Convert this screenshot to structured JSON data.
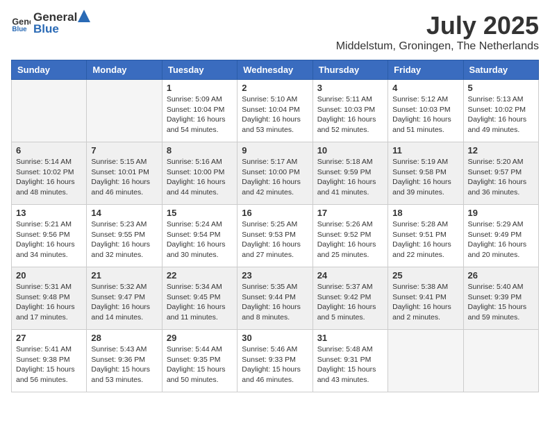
{
  "header": {
    "logo_general": "General",
    "logo_blue": "Blue",
    "month_title": "July 2025",
    "location": "Middelstum, Groningen, The Netherlands"
  },
  "weekdays": [
    "Sunday",
    "Monday",
    "Tuesday",
    "Wednesday",
    "Thursday",
    "Friday",
    "Saturday"
  ],
  "weeks": [
    [
      {
        "day": "",
        "info": ""
      },
      {
        "day": "",
        "info": ""
      },
      {
        "day": "1",
        "info": "Sunrise: 5:09 AM\nSunset: 10:04 PM\nDaylight: 16 hours\nand 54 minutes."
      },
      {
        "day": "2",
        "info": "Sunrise: 5:10 AM\nSunset: 10:04 PM\nDaylight: 16 hours\nand 53 minutes."
      },
      {
        "day": "3",
        "info": "Sunrise: 5:11 AM\nSunset: 10:03 PM\nDaylight: 16 hours\nand 52 minutes."
      },
      {
        "day": "4",
        "info": "Sunrise: 5:12 AM\nSunset: 10:03 PM\nDaylight: 16 hours\nand 51 minutes."
      },
      {
        "day": "5",
        "info": "Sunrise: 5:13 AM\nSunset: 10:02 PM\nDaylight: 16 hours\nand 49 minutes."
      }
    ],
    [
      {
        "day": "6",
        "info": "Sunrise: 5:14 AM\nSunset: 10:02 PM\nDaylight: 16 hours\nand 48 minutes."
      },
      {
        "day": "7",
        "info": "Sunrise: 5:15 AM\nSunset: 10:01 PM\nDaylight: 16 hours\nand 46 minutes."
      },
      {
        "day": "8",
        "info": "Sunrise: 5:16 AM\nSunset: 10:00 PM\nDaylight: 16 hours\nand 44 minutes."
      },
      {
        "day": "9",
        "info": "Sunrise: 5:17 AM\nSunset: 10:00 PM\nDaylight: 16 hours\nand 42 minutes."
      },
      {
        "day": "10",
        "info": "Sunrise: 5:18 AM\nSunset: 9:59 PM\nDaylight: 16 hours\nand 41 minutes."
      },
      {
        "day": "11",
        "info": "Sunrise: 5:19 AM\nSunset: 9:58 PM\nDaylight: 16 hours\nand 39 minutes."
      },
      {
        "day": "12",
        "info": "Sunrise: 5:20 AM\nSunset: 9:57 PM\nDaylight: 16 hours\nand 36 minutes."
      }
    ],
    [
      {
        "day": "13",
        "info": "Sunrise: 5:21 AM\nSunset: 9:56 PM\nDaylight: 16 hours\nand 34 minutes."
      },
      {
        "day": "14",
        "info": "Sunrise: 5:23 AM\nSunset: 9:55 PM\nDaylight: 16 hours\nand 32 minutes."
      },
      {
        "day": "15",
        "info": "Sunrise: 5:24 AM\nSunset: 9:54 PM\nDaylight: 16 hours\nand 30 minutes."
      },
      {
        "day": "16",
        "info": "Sunrise: 5:25 AM\nSunset: 9:53 PM\nDaylight: 16 hours\nand 27 minutes."
      },
      {
        "day": "17",
        "info": "Sunrise: 5:26 AM\nSunset: 9:52 PM\nDaylight: 16 hours\nand 25 minutes."
      },
      {
        "day": "18",
        "info": "Sunrise: 5:28 AM\nSunset: 9:51 PM\nDaylight: 16 hours\nand 22 minutes."
      },
      {
        "day": "19",
        "info": "Sunrise: 5:29 AM\nSunset: 9:49 PM\nDaylight: 16 hours\nand 20 minutes."
      }
    ],
    [
      {
        "day": "20",
        "info": "Sunrise: 5:31 AM\nSunset: 9:48 PM\nDaylight: 16 hours\nand 17 minutes."
      },
      {
        "day": "21",
        "info": "Sunrise: 5:32 AM\nSunset: 9:47 PM\nDaylight: 16 hours\nand 14 minutes."
      },
      {
        "day": "22",
        "info": "Sunrise: 5:34 AM\nSunset: 9:45 PM\nDaylight: 16 hours\nand 11 minutes."
      },
      {
        "day": "23",
        "info": "Sunrise: 5:35 AM\nSunset: 9:44 PM\nDaylight: 16 hours\nand 8 minutes."
      },
      {
        "day": "24",
        "info": "Sunrise: 5:37 AM\nSunset: 9:42 PM\nDaylight: 16 hours\nand 5 minutes."
      },
      {
        "day": "25",
        "info": "Sunrise: 5:38 AM\nSunset: 9:41 PM\nDaylight: 16 hours\nand 2 minutes."
      },
      {
        "day": "26",
        "info": "Sunrise: 5:40 AM\nSunset: 9:39 PM\nDaylight: 15 hours\nand 59 minutes."
      }
    ],
    [
      {
        "day": "27",
        "info": "Sunrise: 5:41 AM\nSunset: 9:38 PM\nDaylight: 15 hours\nand 56 minutes."
      },
      {
        "day": "28",
        "info": "Sunrise: 5:43 AM\nSunset: 9:36 PM\nDaylight: 15 hours\nand 53 minutes."
      },
      {
        "day": "29",
        "info": "Sunrise: 5:44 AM\nSunset: 9:35 PM\nDaylight: 15 hours\nand 50 minutes."
      },
      {
        "day": "30",
        "info": "Sunrise: 5:46 AM\nSunset: 9:33 PM\nDaylight: 15 hours\nand 46 minutes."
      },
      {
        "day": "31",
        "info": "Sunrise: 5:48 AM\nSunset: 9:31 PM\nDaylight: 15 hours\nand 43 minutes."
      },
      {
        "day": "",
        "info": ""
      },
      {
        "day": "",
        "info": ""
      }
    ]
  ]
}
